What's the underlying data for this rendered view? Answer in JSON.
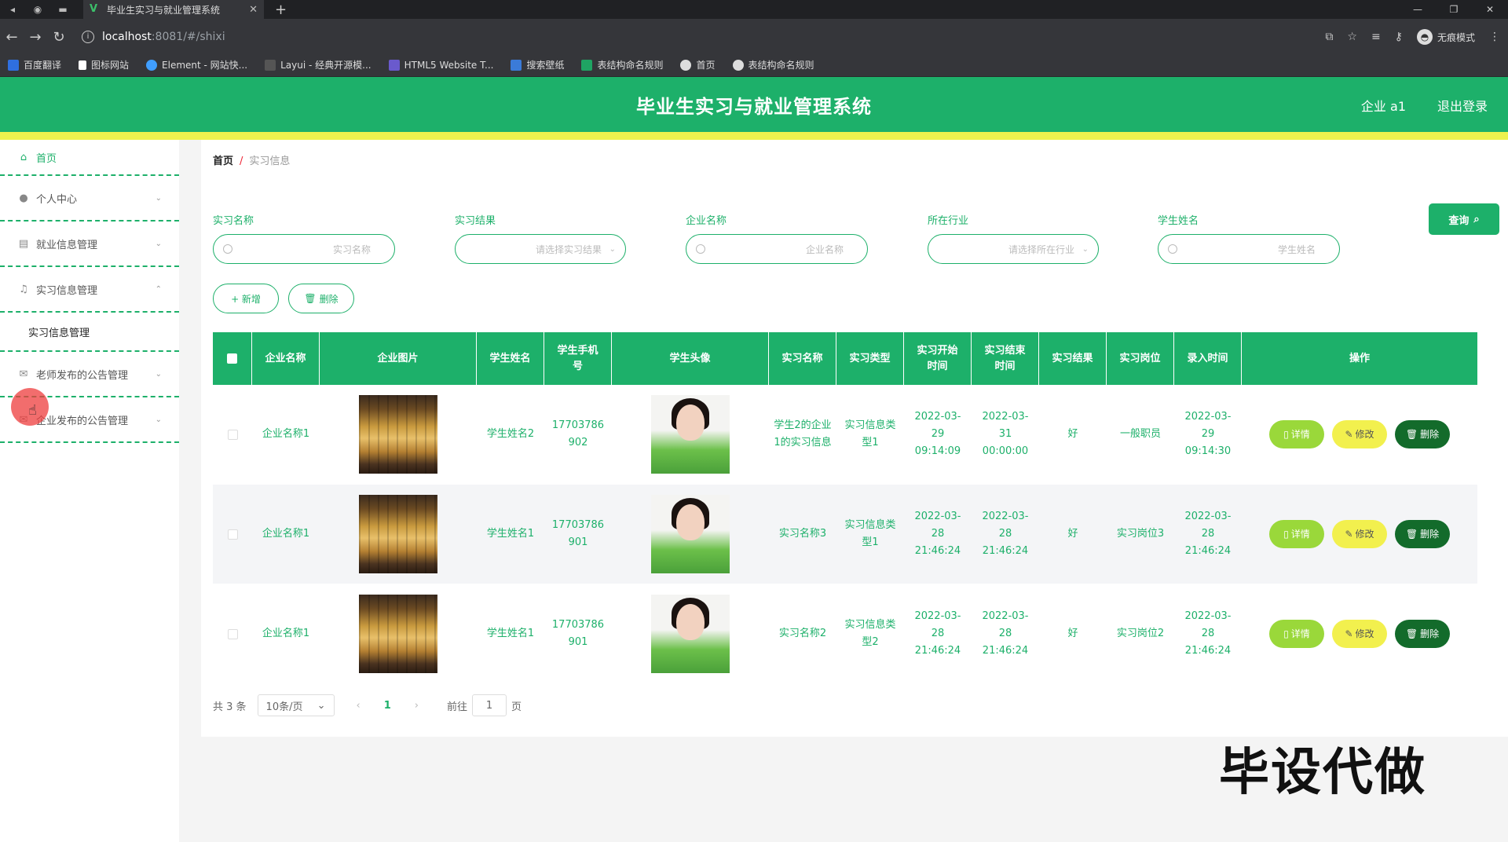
{
  "browser": {
    "tab_title": "毕业生实习与就业管理系统",
    "url_host": "localhost",
    "url_path": ":8081/#/shixi",
    "profile_label": "无痕模式",
    "bookmarks": [
      "百度翻译",
      "图标网站",
      "Element - 网站快...",
      "Layui - 经典开源模...",
      "HTML5 Website T...",
      "搜索壁纸",
      "表结构命名规则",
      "首页",
      "表结构命名规则"
    ]
  },
  "header": {
    "title": "毕业生实习与就业管理系统",
    "user": "企业 a1",
    "logout": "退出登录"
  },
  "sidebar": {
    "items": [
      {
        "label": "首页",
        "icon": "home-icon"
      },
      {
        "label": "个人中心",
        "icon": "user-icon"
      },
      {
        "label": "就业信息管理",
        "icon": "clipboard-icon"
      },
      {
        "label": "实习信息管理",
        "icon": "bell-icon"
      },
      {
        "label": "实习信息管理",
        "icon": ""
      },
      {
        "label": "老师发布的公告管理",
        "icon": "mail-icon"
      },
      {
        "label": "企业发布的公告管理",
        "icon": "mail-icon"
      }
    ]
  },
  "breadcrumb": {
    "home": "首页",
    "sep": "/",
    "current": "实习信息"
  },
  "filters": {
    "f1": {
      "label": "实习名称",
      "placeholder": "实习名称"
    },
    "f2": {
      "label": "实习结果",
      "placeholder": "请选择实习结果"
    },
    "f3": {
      "label": "企业名称",
      "placeholder": "企业名称"
    },
    "f4": {
      "label": "所在行业",
      "placeholder": "请选择所在行业"
    },
    "f5": {
      "label": "学生姓名",
      "placeholder": "学生姓名"
    },
    "query": "查询"
  },
  "toolbar": {
    "add": "+ 新增",
    "delete": "删除"
  },
  "table": {
    "headers": [
      "企业名称",
      "企业图片",
      "学生姓名",
      "学生手机号",
      "学生头像",
      "实习名称",
      "实习类型",
      "实习开始时间",
      "实习结束时间",
      "实习结果",
      "实习岗位",
      "录入时间",
      "操作"
    ],
    "rows": [
      {
        "company": "企业名称1",
        "student": "学生姓名2",
        "phone": "17703786902",
        "name": "学生2的企业1的实习信息",
        "type": "实习信息类型1",
        "start": "2022-03-29 09:14:09",
        "end": "2022-03-31 00:00:00",
        "result": "好",
        "post": "一般职员",
        "created": "2022-03-29 09:14:30"
      },
      {
        "company": "企业名称1",
        "student": "学生姓名1",
        "phone": "17703786901",
        "name": "实习名称3",
        "type": "实习信息类型1",
        "start": "2022-03-28 21:46:24",
        "end": "2022-03-28 21:46:24",
        "result": "好",
        "post": "实习岗位3",
        "created": "2022-03-28 21:46:24"
      },
      {
        "company": "企业名称1",
        "student": "学生姓名1",
        "phone": "17703786901",
        "name": "实习名称2",
        "type": "实习信息类型2",
        "start": "2022-03-28 21:46:24",
        "end": "2022-03-28 21:46:24",
        "result": "好",
        "post": "实习岗位2",
        "created": "2022-03-28 21:46:24"
      }
    ],
    "actions": {
      "detail": "详情",
      "edit": "修改",
      "delete": "删除"
    }
  },
  "pager": {
    "total": "共 3 条",
    "size": "10条/页",
    "page": "1",
    "goto": "前往",
    "goto_value": "1",
    "unit": "页"
  },
  "watermark": "毕设代做"
}
